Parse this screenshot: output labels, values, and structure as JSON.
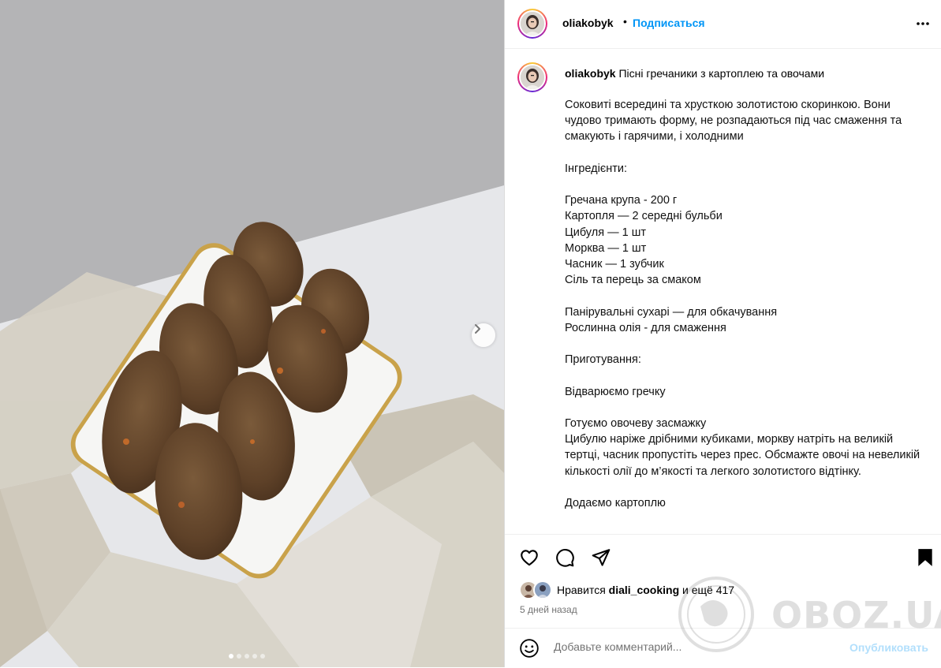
{
  "post": {
    "username": "oliakobyk",
    "follow_label": "Подписаться",
    "bullet": "•",
    "caption_title": "Пісні гречаники з картоплею та овочами",
    "caption_lines": [
      "Соковиті всередині та хрусткою золотистою скоринкою. Вони чудово тримають форму, не розпадаються під час смаження та смакують і гарячими, і холодними",
      "",
      "Інгредієнти:",
      "",
      "Гречана крупа - 200 г",
      "Картопля — 2 середні бульби",
      "Цибуля — 1 шт",
      "Морква — 1 шт",
      "Часник — 1 зубчик",
      "Сіль та перець за смаком",
      "",
      "Панірувальні сухарі — для обкачування",
      "Рослинна олія - для смаження",
      "",
      "Приготування:",
      "",
      "Відварюємо гречку",
      "",
      "Готуємо овочеву засмажку",
      "Цибулю наріже дрібними кубиками, моркву натріть на великій тертці, часник пропустіть через прес. Обсмажте овочі на невеликій кількості олії до м’якості та легкого золотистого відтінку.",
      "",
      "Додаємо картоплю"
    ],
    "likes_prefix": "Нравится",
    "likes_user": "diali_cooking",
    "likes_suffix": "и ещё 417",
    "time_ago": "5 дней назад",
    "comment_placeholder": "Добавьте комментарий...",
    "publish_label": "Опубликовать",
    "carousel": {
      "count": 5,
      "active": 1
    }
  },
  "icons": {
    "more": "more-horizontal-icon",
    "like": "heart-icon",
    "comment": "comment-icon",
    "share": "paper-plane-icon",
    "save": "bookmark-icon",
    "emoji": "smiley-icon",
    "next": "chevron-right-icon"
  },
  "colors": {
    "link_blue": "#0095f6",
    "publish_disabled": "#b2dffc",
    "muted": "#737373"
  },
  "watermark": {
    "text": "OBOZ.UA"
  }
}
